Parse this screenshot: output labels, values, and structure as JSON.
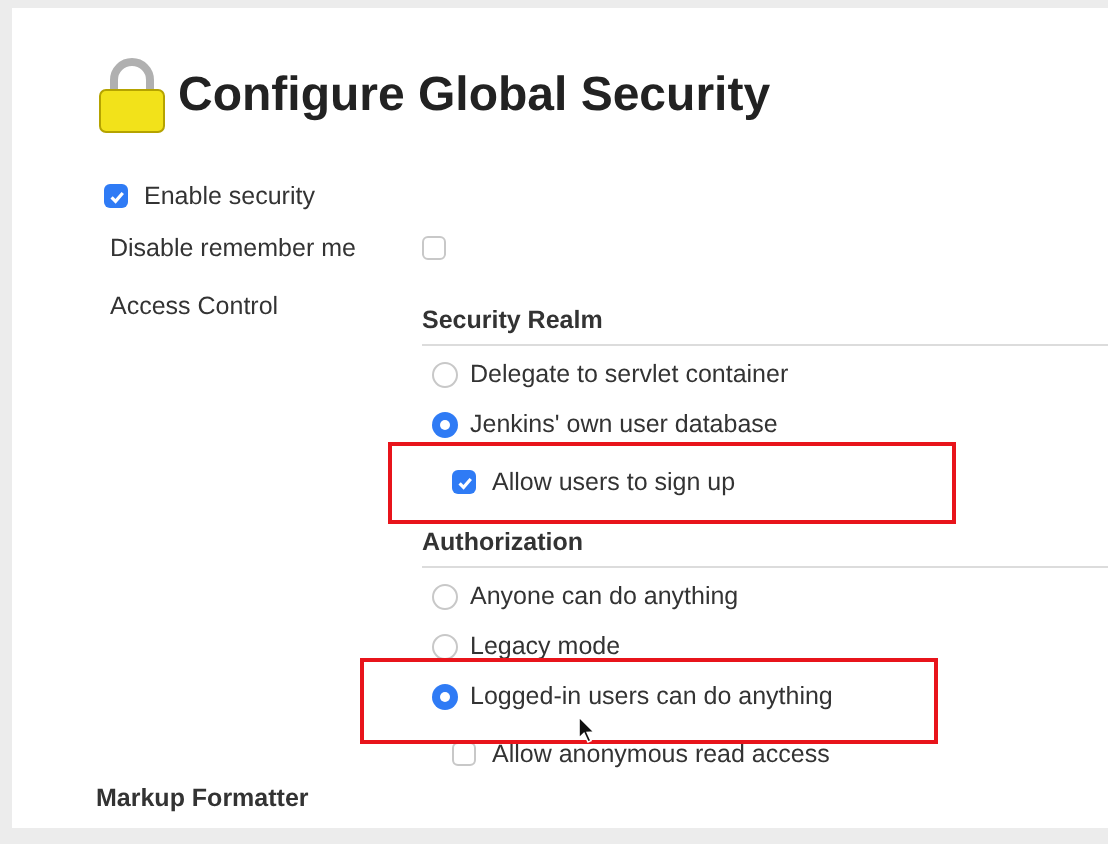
{
  "title": "Configure Global Security",
  "enable_security": {
    "label": "Enable security",
    "checked": true
  },
  "disable_remember_me": {
    "label": "Disable remember me",
    "checked": false
  },
  "access_control": {
    "label": "Access Control",
    "sections": [
      {
        "heading": "Security Realm",
        "options": [
          {
            "label": "Delegate to servlet container",
            "selected": false
          },
          {
            "label": "Jenkins' own user database",
            "selected": true,
            "sub_option": {
              "label": "Allow users to sign up",
              "checked": true
            }
          }
        ]
      },
      {
        "heading": "Authorization",
        "options": [
          {
            "label": "Anyone can do anything",
            "selected": false
          },
          {
            "label": "Legacy mode",
            "selected": false
          },
          {
            "label": "Logged-in users can do anything",
            "selected": true,
            "sub_option": {
              "label": "Allow anonymous read access",
              "checked": false
            }
          }
        ]
      }
    ]
  },
  "next_section": {
    "heading": "Markup Formatter"
  }
}
